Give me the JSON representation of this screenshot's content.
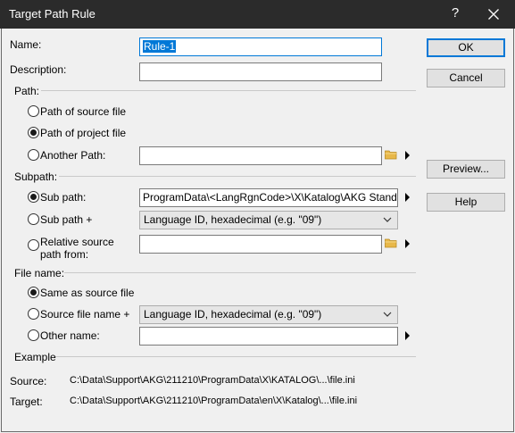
{
  "window": {
    "title": "Target Path Rule",
    "help_glyph": "?",
    "close_glyph": "✕"
  },
  "fields": {
    "name_label": "Name:",
    "name_value": "Rule-1",
    "description_label": "Description:",
    "description_value": ""
  },
  "path_section": {
    "header": "Path:",
    "opt_source": "Path of source file",
    "opt_project": "Path of project file",
    "opt_another": "Another Path:",
    "selected": "project",
    "another_value": ""
  },
  "subpath_section": {
    "header": "Subpath:",
    "opt_sub": "Sub path:",
    "sub_value": "ProgramData\\<LangRgnCode>\\X\\Katalog\\AKG Standard",
    "opt_sub_plus": "Sub path +",
    "sub_plus_select": "Language ID, hexadecimal (e.g. \"09\")",
    "opt_relative_line1": "Relative source",
    "opt_relative_line2": "path from:",
    "relative_value": "",
    "selected": "sub"
  },
  "filename_section": {
    "header": "File name:",
    "opt_same": "Same as source file",
    "opt_source_plus": "Source file name +",
    "source_plus_select": "Language ID, hexadecimal (e.g. \"09\")",
    "opt_other": "Other name:",
    "other_value": "",
    "selected": "same"
  },
  "example": {
    "header": "Example",
    "source_label": "Source:",
    "source_value": "C:\\Data\\Support\\AKG\\211210\\ProgramData\\X\\KATALOG\\...\\file.ini",
    "target_label": "Target:",
    "target_value": "C:\\Data\\Support\\AKG\\211210\\ProgramData\\en\\X\\Katalog\\...\\file.ini"
  },
  "buttons": {
    "ok": "OK",
    "cancel": "Cancel",
    "preview": "Preview...",
    "help": "Help"
  },
  "colors": {
    "titlebar": "#2b2b2b",
    "accent": "#0078d7",
    "folder": "#e8b84a"
  }
}
